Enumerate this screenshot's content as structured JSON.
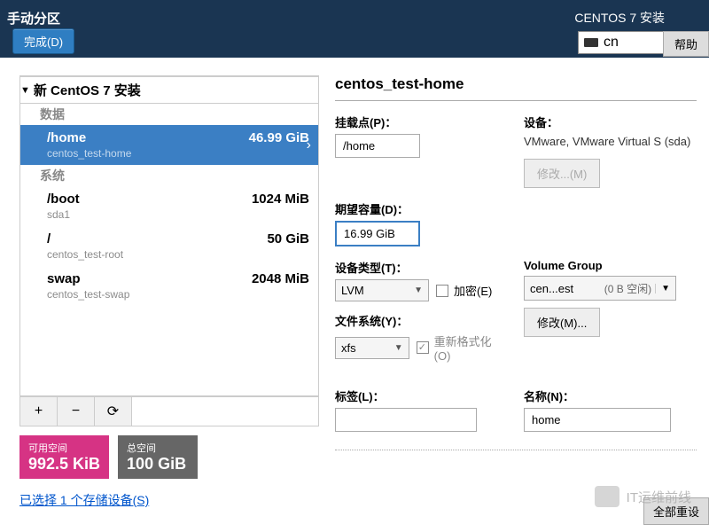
{
  "topbar": {
    "title": "手动分区",
    "done": "完成(D)",
    "installer": "CENTOS 7 安装",
    "keyboard": "cn",
    "help": "帮助"
  },
  "tree": {
    "title": "新 CentOS 7 安装",
    "data_label": "数据",
    "system_label": "系统",
    "partitions": [
      {
        "mount": "/home",
        "dev": "centos_test-home",
        "size": "46.99 GiB",
        "selected": true
      },
      {
        "mount": "/boot",
        "dev": "sda1",
        "size": "1024 MiB",
        "selected": false
      },
      {
        "mount": "/",
        "dev": "centos_test-root",
        "size": "50 GiB",
        "selected": false
      },
      {
        "mount": "swap",
        "dev": "centos_test-swap",
        "size": "2048 MiB",
        "selected": false
      }
    ],
    "add": "+",
    "remove": "−",
    "reload": "⟳"
  },
  "space": {
    "avail_label": "可用空间",
    "avail_val": "992.5 KiB",
    "total_label": "总空间",
    "total_val": "100 GiB"
  },
  "storage_link": "已选择 1 个存储设备(S)",
  "details": {
    "title": "centos_test-home",
    "mount_label": "挂载点(P)：",
    "mount_val": "/home",
    "device_label": "设备：",
    "device_val": "VMware, VMware Virtual S (sda)",
    "modify_btn": "修改...(M)",
    "capacity_label": "期望容量(D)：",
    "capacity_val": "16.99 GiB",
    "type_label": "设备类型(T)：",
    "type_val": "LVM",
    "encrypt_label": "加密(E)",
    "vg_label": "Volume Group",
    "vg_val": "cen...est",
    "vg_space": "(0 B 空闲)",
    "modify2_btn": "修改(M)...",
    "fs_label": "文件系统(Y)：",
    "fs_val": "xfs",
    "reformat_label": "重新格式化(O)",
    "tag_label": "标签(L)：",
    "tag_val": "",
    "name_label": "名称(N)：",
    "name_val": "home"
  },
  "reset_all": "全部重设",
  "watermark": "IT运维前线"
}
